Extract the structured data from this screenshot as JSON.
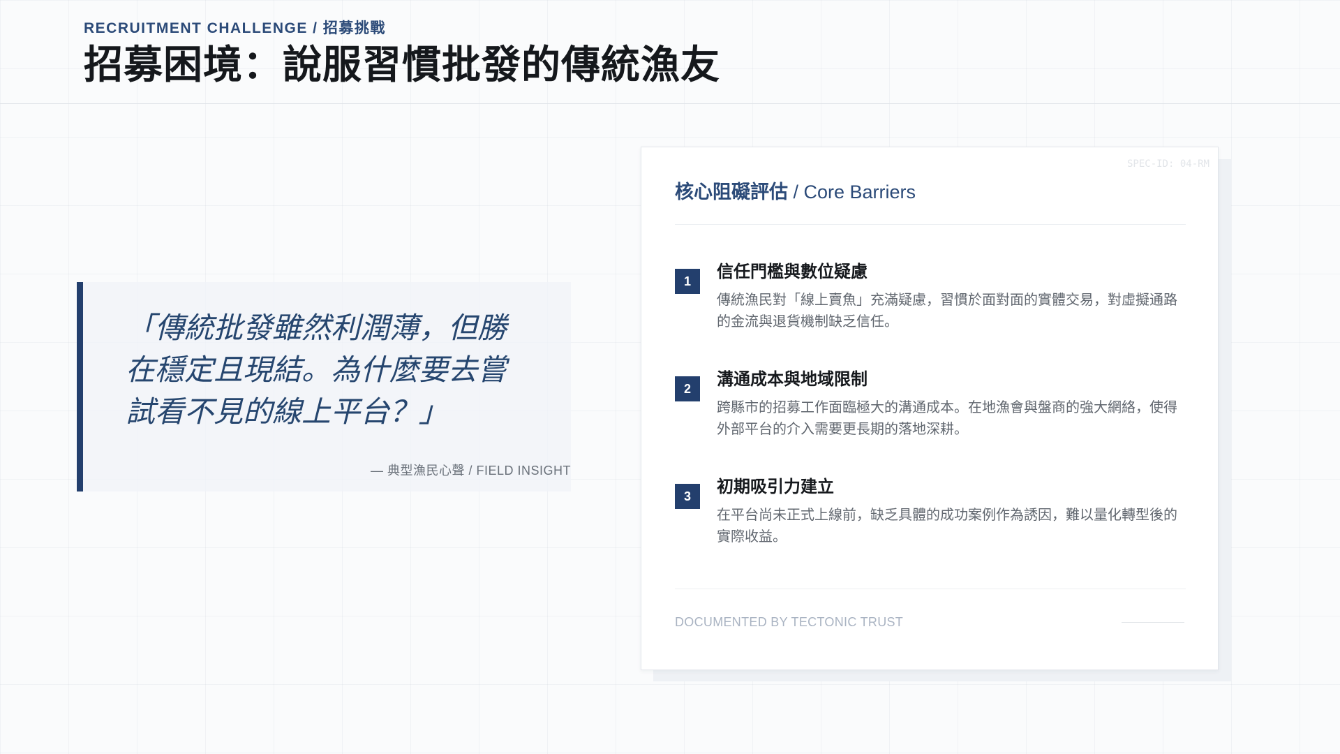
{
  "header": {
    "eyebrow": "RECRUITMENT CHALLENGE / 招募挑戰",
    "title": "招募困境：說服習慣批發的傳統漁友"
  },
  "quote": {
    "text": "「傳統批發雖然利潤薄，但勝在穩定且現結。為什麼要去嘗試看不見的線上平台？」",
    "attribution": "— 典型漁民心聲 / FIELD INSIGHT"
  },
  "card": {
    "spec_id": "SPEC-ID: 04-RM",
    "title_zh": "核心阻礙評估",
    "title_en": " / Core Barriers",
    "barriers": [
      {
        "number": "1",
        "title": "信任門檻與數位疑慮",
        "description": "傳統漁民對「線上賣魚」充滿疑慮，習慣於面對面的實體交易，對虛擬通路的金流與退貨機制缺乏信任。"
      },
      {
        "number": "2",
        "title": "溝通成本與地域限制",
        "description": "跨縣市的招募工作面臨極大的溝通成本。在地漁會與盤商的強大網絡，使得外部平台的介入需要更長期的落地深耕。"
      },
      {
        "number": "3",
        "title": "初期吸引力建立",
        "description": "在平台尚未正式上線前，缺乏具體的成功案例作為誘因，難以量化轉型後的實際收益。"
      }
    ],
    "footer": "DOCUMENTED BY TECTONIC TRUST"
  },
  "colors": {
    "accent": "#233f6d",
    "eyebrow": "#2b4a78",
    "quote_text": "#26466f",
    "footer_text": "#a9b3c2"
  }
}
